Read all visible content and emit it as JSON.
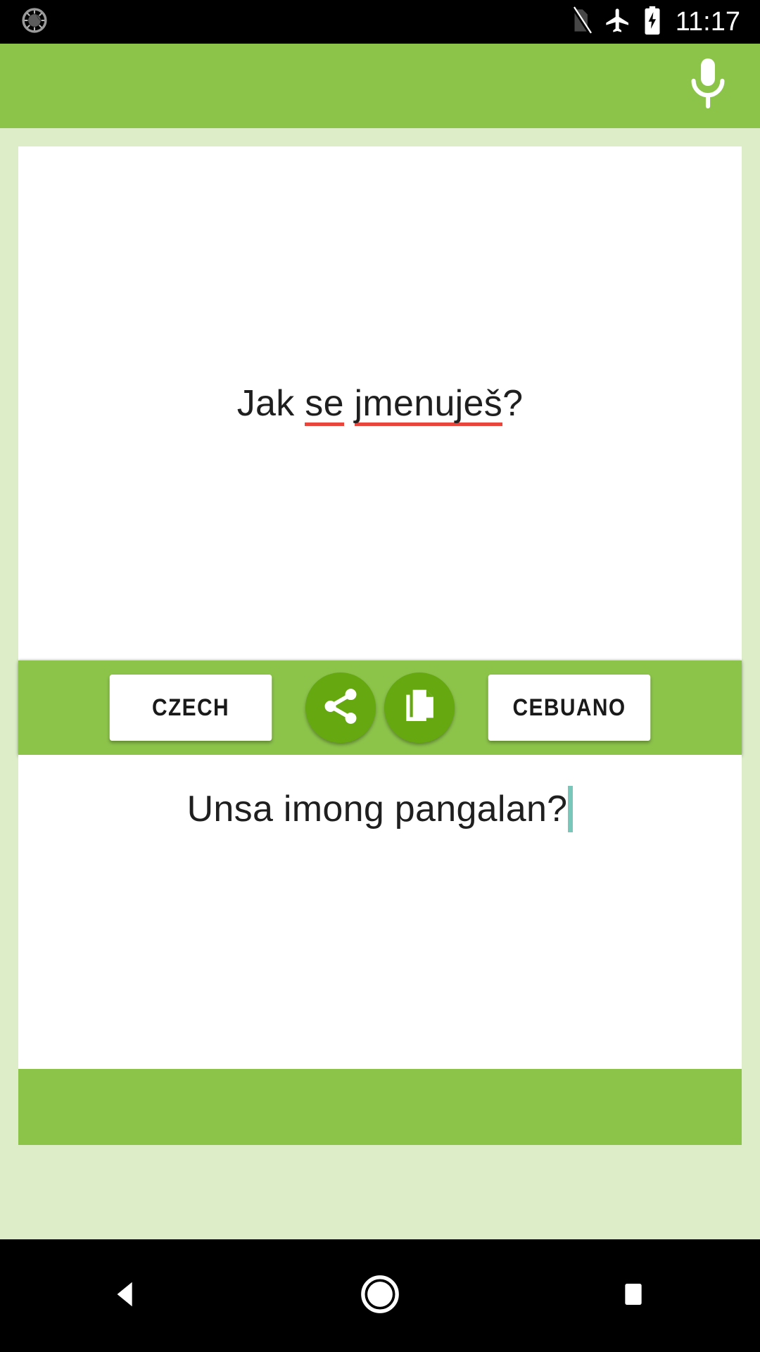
{
  "status_bar": {
    "notification_icon": "sun-notification-icon",
    "icons": [
      "no-sim-icon",
      "airplane-mode-icon",
      "battery-charging-icon"
    ],
    "time": "11:17"
  },
  "app_bar": {
    "mic_icon": "microphone-icon"
  },
  "source_panel": {
    "text_plain": "Jak se jmenuješ?",
    "segments": [
      {
        "text": "Jak ",
        "misspelled": false
      },
      {
        "text": "se",
        "misspelled": true
      },
      {
        "text": " ",
        "misspelled": false
      },
      {
        "text": "jmenuješ",
        "misspelled": true
      },
      {
        "text": "?",
        "misspelled": false
      }
    ],
    "spellcheck_color": "#e8453c"
  },
  "language_bar": {
    "source_language": "CZECH",
    "target_language": "CEBUANO",
    "share_icon": "share-icon",
    "copy_icon": "copy-icon",
    "bar_color": "#8cc44a",
    "action_button_color": "#65a80f"
  },
  "target_panel": {
    "text": "Unsa imong pangalan?",
    "cursor_color": "#79c6bb",
    "cursor_visible": "true"
  },
  "nav_bar": {
    "back_icon": "back-triangle-icon",
    "home_icon": "home-circle-icon",
    "recents_icon": "recents-square-icon"
  },
  "theme": {
    "accent": "#8cc44a",
    "background": "#dcedc8",
    "card": "#ffffff",
    "dark_accent": "#65a80f",
    "system_bar": "#000000"
  }
}
